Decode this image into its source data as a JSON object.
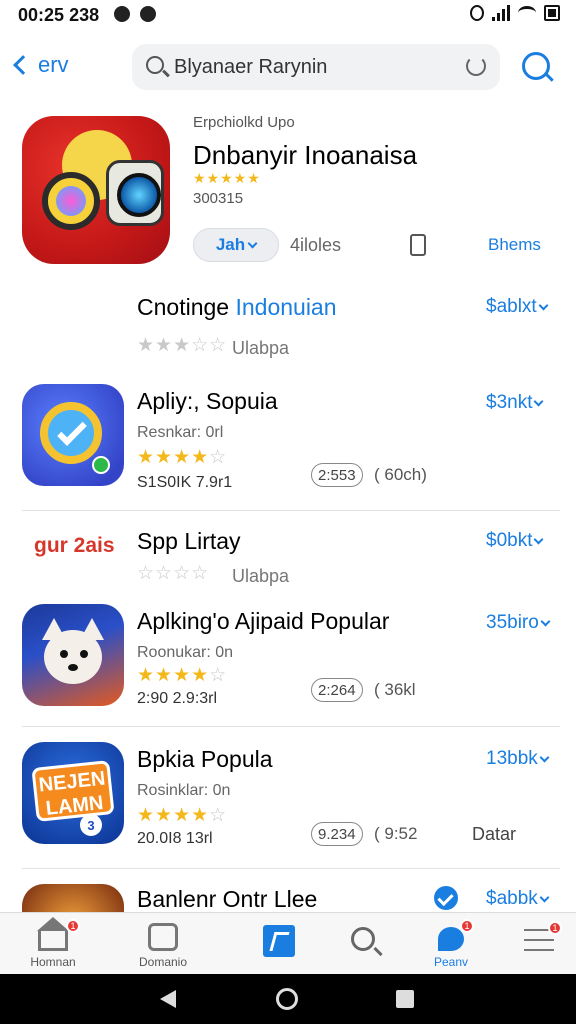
{
  "status_bar": {
    "time": "00:25",
    "extra": "238"
  },
  "header": {
    "back_label": "erv",
    "search_text": "Blyanaer Rarynin"
  },
  "featured": {
    "subtitle": "Erpchiolkd Upo",
    "title": "Dnbanyir Inoanaisa",
    "stars": "★★★★★",
    "count": "300315",
    "get_label": "Jah",
    "meta": "4iloles",
    "link": "Bhems"
  },
  "rows": [
    {
      "title_black": "Cnotinge ",
      "title_blue": "Indonuian",
      "price": "$ablxt",
      "stars_on": 3,
      "stars_total": 5,
      "star_label": "Ulabpa"
    },
    {
      "title": "Apliy:, Sopuia",
      "price": "$3nkt",
      "sub": "Resnkar: 0rl",
      "stars_on": 4,
      "stars_total": 5,
      "info": "S1S0IK 7.9r1",
      "pill": "2:553",
      "size": "( 60ch)"
    },
    {
      "brand": "gur 2ais",
      "title": "Spp Lirtay",
      "price": "$0bkt",
      "stars_on": 0,
      "stars_total": 5,
      "star_label": "Ulabpa"
    },
    {
      "title": "Aplking'o Ajipaid Popular",
      "price": "35biro",
      "sub": "Roonukar: 0n",
      "stars_on": 4,
      "stars_total": 5,
      "info": "2:90 2.9:3rl",
      "pill": "2:264",
      "size": "( 36kl"
    },
    {
      "title": "Bpkia Popula",
      "price": "13bbk",
      "sub": "Rosinklar: 0n",
      "stars_on": 4,
      "stars_total": 5,
      "info": "20.0I8 13rl",
      "pill": "9.234",
      "size": "( 9:52",
      "extra": "Datar"
    },
    {
      "title": "Banlenr Ontr Llee",
      "price": "$abbk"
    }
  ],
  "news_icon": {
    "line1": "NEJEN",
    "line2": "LAMN",
    "badge": "3"
  },
  "tabbar": {
    "tabs": [
      {
        "label": "Homnan",
        "badge": "1"
      },
      {
        "label": "Domanio"
      },
      {
        "label": ""
      },
      {
        "label": ""
      },
      {
        "label": "Peanv",
        "badge": "1"
      },
      {
        "label": "",
        "badge": "1"
      }
    ]
  },
  "colors": {
    "accent": "#1a7ee0",
    "star": "#f3b81a"
  }
}
